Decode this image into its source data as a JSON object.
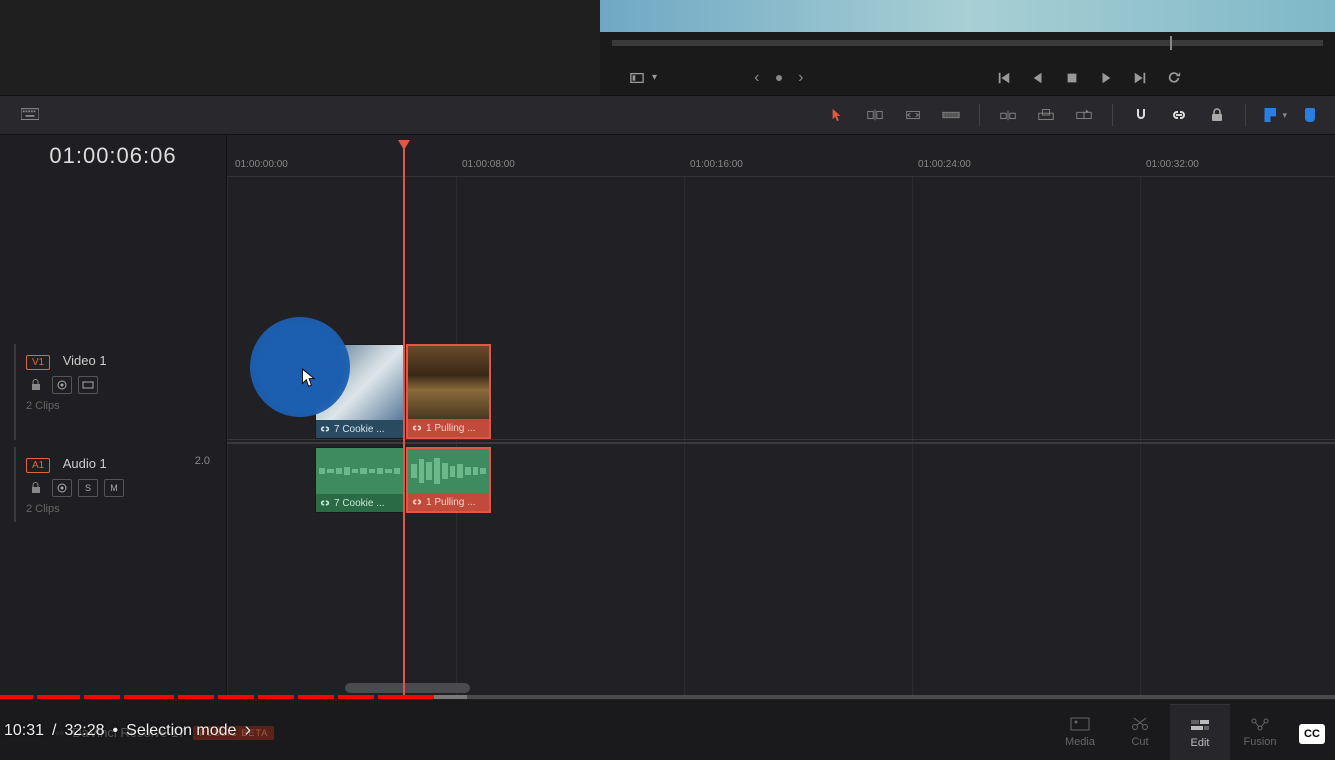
{
  "viewer": {
    "options_icon": "viewer-options"
  },
  "transport": {
    "prev_clip": "prev-clip",
    "play_back": "play-back",
    "stop": "stop",
    "play": "play",
    "next_clip": "next-clip",
    "loop": "loop"
  },
  "toolbar": {
    "keyboard": "keyboard",
    "arrow": "arrow",
    "trim_edit": "trim-edit",
    "insert_edit": "insert-edit",
    "razor": "razor",
    "ripple_overwrite": "ripple-overwrite",
    "replace": "replace",
    "fit_to_fill": "fit-to-fill",
    "snap": "snap",
    "link": "link",
    "lock": "lock",
    "flag": "flag",
    "marker": "marker"
  },
  "timecode": "01:00:06:06",
  "ruler": {
    "ticks": [
      "01:00:00:00",
      "01:00:08:00",
      "01:00:16:00",
      "01:00:24:00",
      "01:00:32:00"
    ]
  },
  "tracks": {
    "video": {
      "badge": "V1",
      "name": "Video 1",
      "clips_meta": "2 Clips"
    },
    "audio": {
      "badge": "A1",
      "name": "Audio 1",
      "channels": "2.0",
      "clips_meta": "2 Clips",
      "solo": "S",
      "mute": "M"
    }
  },
  "clips": {
    "v1": {
      "label": "7 Cookie ..."
    },
    "v2": {
      "label": "1 Pulling ..."
    },
    "a1": {
      "label": "7 Cookie ..."
    },
    "a2": {
      "label": "1 Pulling ..."
    }
  },
  "player": {
    "current": "10:31",
    "total": "32:28",
    "chapter": "Selection mode",
    "sep": " / ",
    "dot": " • "
  },
  "brand": {
    "name": "DaVinci Resolve 17",
    "beta": "PUBLIC BETA"
  },
  "pages": {
    "media": "Media",
    "cut": "Cut",
    "edit": "Edit",
    "fusion": "Fusion"
  },
  "cc": "CC"
}
